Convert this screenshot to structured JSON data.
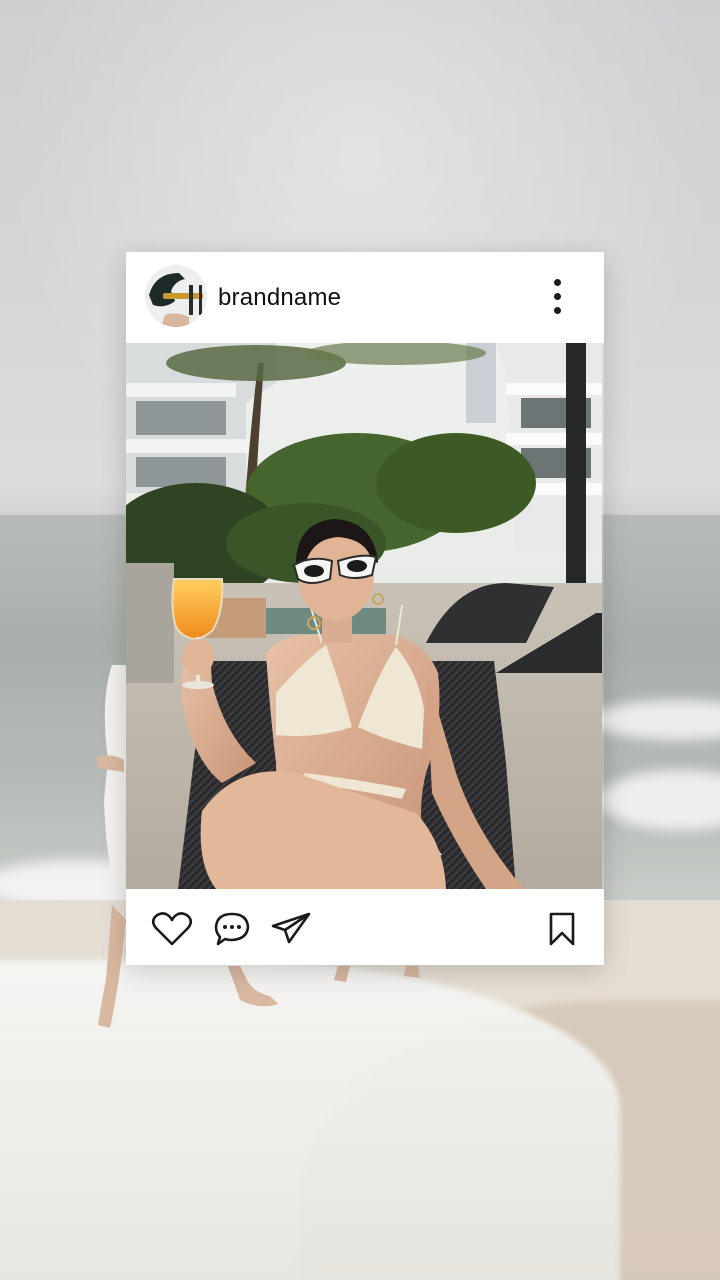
{
  "post": {
    "username": "brandname"
  },
  "icons": {
    "more": "vertical-ellipsis-icon",
    "like": "heart-icon",
    "comment": "comment-bubble-icon",
    "share": "paper-plane-icon",
    "save": "bookmark-icon"
  },
  "colors": {
    "card_background": "#ffffff",
    "icon_stroke": "#1a1a1a",
    "text": "#111111"
  }
}
